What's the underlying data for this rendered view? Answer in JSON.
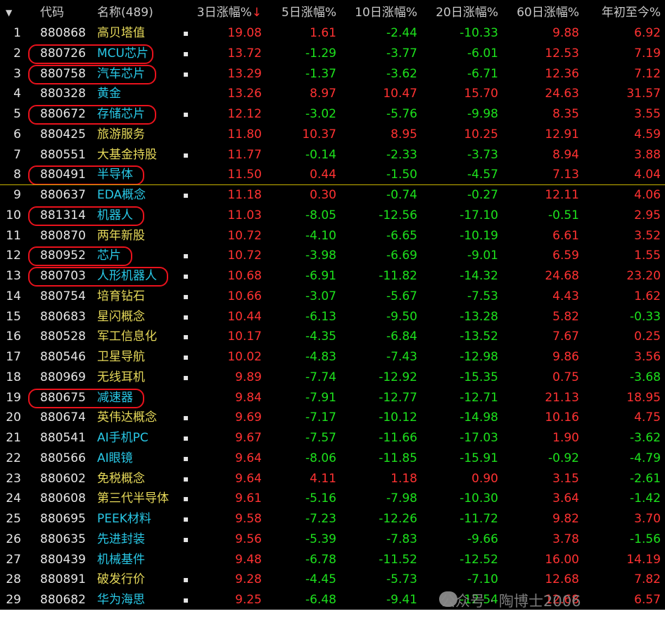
{
  "colors": {
    "up": "#ff3232",
    "down": "#1de11d",
    "name_yellow": "#e6d95a",
    "name_cyan": "#29c8e6",
    "bg": "#000000"
  },
  "header": {
    "menu_icon": "triangle-down-icon",
    "index_label": "",
    "code_label": "代码",
    "name_label": "名称(489)",
    "d3_label": "3日涨幅%",
    "d3_sort_arrow": "↓",
    "d5_label": "5日涨幅%",
    "d10_label": "10日涨幅%",
    "d20_label": "20日涨幅%",
    "d60_label": "60日涨幅%",
    "ytd_label": "年初至今%"
  },
  "rows": [
    {
      "idx": "1",
      "code": "880868",
      "name": "高贝塔值",
      "name_color": "yellow",
      "dot": "▪",
      "d3": "19.08",
      "d5": "1.61",
      "d10": "-2.44",
      "d20": "-10.33",
      "d60": "9.88",
      "ytd": "6.92",
      "circled": false
    },
    {
      "idx": "2",
      "code": "880726",
      "name": "MCU芯片",
      "name_color": "cyan",
      "dot": "▪",
      "d3": "13.72",
      "d5": "-1.29",
      "d10": "-3.77",
      "d20": "-6.01",
      "d60": "12.53",
      "ytd": "7.19",
      "circled": true
    },
    {
      "idx": "3",
      "code": "880758",
      "name": "汽车芯片",
      "name_color": "cyan",
      "dot": "▪",
      "d3": "13.29",
      "d5": "-1.37",
      "d10": "-3.62",
      "d20": "-6.71",
      "d60": "12.36",
      "ytd": "7.12",
      "circled": true
    },
    {
      "idx": "4",
      "code": "880328",
      "name": "黄金",
      "name_color": "cyan",
      "dot": "",
      "d3": "13.26",
      "d5": "8.97",
      "d10": "10.47",
      "d20": "15.70",
      "d60": "24.63",
      "ytd": "31.57",
      "circled": false
    },
    {
      "idx": "5",
      "code": "880672",
      "name": "存储芯片",
      "name_color": "cyan",
      "dot": "▪",
      "d3": "12.12",
      "d5": "-3.02",
      "d10": "-5.76",
      "d20": "-9.98",
      "d60": "8.35",
      "ytd": "3.55",
      "circled": true
    },
    {
      "idx": "6",
      "code": "880425",
      "name": "旅游服务",
      "name_color": "yellow",
      "dot": "",
      "d3": "11.80",
      "d5": "10.37",
      "d10": "8.95",
      "d20": "10.25",
      "d60": "12.91",
      "ytd": "4.59",
      "circled": false
    },
    {
      "idx": "7",
      "code": "880551",
      "name": "大基金持股",
      "name_color": "yellow",
      "dot": "▪",
      "d3": "11.77",
      "d5": "-0.14",
      "d10": "-2.33",
      "d20": "-3.73",
      "d60": "8.94",
      "ytd": "3.88",
      "circled": false
    },
    {
      "idx": "8",
      "code": "880491",
      "name": "半导体",
      "name_color": "cyan",
      "dot": "",
      "d3": "11.50",
      "d5": "0.44",
      "d10": "-1.50",
      "d20": "-4.57",
      "d60": "7.13",
      "ytd": "4.04",
      "circled": true
    },
    {
      "idx": "9",
      "code": "880637",
      "name": "EDA概念",
      "name_color": "cyan",
      "dot": "▪",
      "d3": "11.18",
      "d5": "0.30",
      "d10": "-0.74",
      "d20": "-0.27",
      "d60": "12.11",
      "ytd": "4.06",
      "circled": false
    },
    {
      "idx": "10",
      "code": "881314",
      "name": "机器人",
      "name_color": "cyan",
      "dot": "",
      "d3": "11.03",
      "d5": "-8.05",
      "d10": "-12.56",
      "d20": "-17.10",
      "d60": "-0.51",
      "ytd": "2.95",
      "circled": true
    },
    {
      "idx": "11",
      "code": "880870",
      "name": "两年新股",
      "name_color": "yellow",
      "dot": "",
      "d3": "10.72",
      "d5": "-4.10",
      "d10": "-6.65",
      "d20": "-10.19",
      "d60": "6.61",
      "ytd": "3.52",
      "circled": false
    },
    {
      "idx": "12",
      "code": "880952",
      "name": "芯片",
      "name_color": "cyan",
      "dot": "▪",
      "d3": "10.72",
      "d5": "-3.98",
      "d10": "-6.69",
      "d20": "-9.01",
      "d60": "6.59",
      "ytd": "1.55",
      "circled": true
    },
    {
      "idx": "13",
      "code": "880703",
      "name": "人形机器人",
      "name_color": "cyan",
      "dot": "▪",
      "d3": "10.68",
      "d5": "-6.91",
      "d10": "-11.82",
      "d20": "-14.32",
      "d60": "24.68",
      "ytd": "23.20",
      "circled": true
    },
    {
      "idx": "14",
      "code": "880754",
      "name": "培育钻石",
      "name_color": "yellow",
      "dot": "▪",
      "d3": "10.66",
      "d5": "-3.07",
      "d10": "-5.67",
      "d20": "-7.53",
      "d60": "4.43",
      "ytd": "1.62",
      "circled": false
    },
    {
      "idx": "15",
      "code": "880683",
      "name": "星闪概念",
      "name_color": "yellow",
      "dot": "▪",
      "d3": "10.44",
      "d5": "-6.13",
      "d10": "-9.50",
      "d20": "-13.28",
      "d60": "5.82",
      "ytd": "-0.33",
      "circled": false
    },
    {
      "idx": "16",
      "code": "880528",
      "name": "军工信息化",
      "name_color": "yellow",
      "dot": "▪",
      "d3": "10.17",
      "d5": "-4.35",
      "d10": "-6.84",
      "d20": "-13.52",
      "d60": "7.67",
      "ytd": "0.25",
      "circled": false
    },
    {
      "idx": "17",
      "code": "880546",
      "name": "卫星导航",
      "name_color": "yellow",
      "dot": "▪",
      "d3": "10.02",
      "d5": "-4.83",
      "d10": "-7.43",
      "d20": "-12.98",
      "d60": "9.86",
      "ytd": "3.56",
      "circled": false
    },
    {
      "idx": "18",
      "code": "880969",
      "name": "无线耳机",
      "name_color": "yellow",
      "dot": "▪",
      "d3": "9.89",
      "d5": "-7.74",
      "d10": "-12.92",
      "d20": "-15.35",
      "d60": "0.75",
      "ytd": "-3.68",
      "circled": false
    },
    {
      "idx": "19",
      "code": "880675",
      "name": "减速器",
      "name_color": "cyan",
      "dot": "",
      "d3": "9.84",
      "d5": "-7.91",
      "d10": "-12.77",
      "d20": "-12.71",
      "d60": "21.13",
      "ytd": "18.95",
      "circled": true
    },
    {
      "idx": "20",
      "code": "880674",
      "name": "英伟达概念",
      "name_color": "yellow",
      "dot": "▪",
      "d3": "9.69",
      "d5": "-7.17",
      "d10": "-10.12",
      "d20": "-14.98",
      "d60": "10.16",
      "ytd": "4.75",
      "circled": false
    },
    {
      "idx": "21",
      "code": "880541",
      "name": "AI手机PC",
      "name_color": "cyan",
      "dot": "▪",
      "d3": "9.67",
      "d5": "-7.57",
      "d10": "-11.66",
      "d20": "-17.03",
      "d60": "1.90",
      "ytd": "-3.62",
      "circled": false
    },
    {
      "idx": "22",
      "code": "880566",
      "name": "AI眼镜",
      "name_color": "cyan",
      "dot": "▪",
      "d3": "9.64",
      "d5": "-8.06",
      "d10": "-11.85",
      "d20": "-15.91",
      "d60": "-0.92",
      "ytd": "-4.79",
      "circled": false
    },
    {
      "idx": "23",
      "code": "880602",
      "name": "免税概念",
      "name_color": "yellow",
      "dot": "▪",
      "d3": "9.64",
      "d5": "4.11",
      "d10": "1.18",
      "d20": "0.90",
      "d60": "3.15",
      "ytd": "-2.61",
      "circled": false
    },
    {
      "idx": "24",
      "code": "880608",
      "name": "第三代半导体",
      "name_color": "yellow",
      "dot": "▪",
      "d3": "9.61",
      "d5": "-5.16",
      "d10": "-7.98",
      "d20": "-10.30",
      "d60": "3.64",
      "ytd": "-1.42",
      "circled": false
    },
    {
      "idx": "25",
      "code": "880695",
      "name": "PEEK材料",
      "name_color": "cyan",
      "dot": "▪",
      "d3": "9.58",
      "d5": "-7.23",
      "d10": "-12.26",
      "d20": "-11.72",
      "d60": "9.82",
      "ytd": "3.70",
      "circled": false
    },
    {
      "idx": "26",
      "code": "880635",
      "name": "先进封装",
      "name_color": "cyan",
      "dot": "▪",
      "d3": "9.56",
      "d5": "-5.39",
      "d10": "-7.83",
      "d20": "-9.66",
      "d60": "3.78",
      "ytd": "-1.56",
      "circled": false
    },
    {
      "idx": "27",
      "code": "880439",
      "name": "机械基件",
      "name_color": "cyan",
      "dot": "",
      "d3": "9.48",
      "d5": "-6.78",
      "d10": "-11.52",
      "d20": "-12.52",
      "d60": "16.00",
      "ytd": "14.19",
      "circled": false
    },
    {
      "idx": "28",
      "code": "880891",
      "name": "破发行价",
      "name_color": "yellow",
      "dot": "▪",
      "d3": "9.28",
      "d5": "-4.45",
      "d10": "-5.73",
      "d20": "-7.10",
      "d60": "12.68",
      "ytd": "7.82",
      "circled": false
    },
    {
      "idx": "29",
      "code": "880682",
      "name": "华为海思",
      "name_color": "cyan",
      "dot": "▪",
      "d3": "9.25",
      "d5": "-6.48",
      "d10": "-9.41",
      "d20": "-12.54",
      "d60": "12.68",
      "ytd": "6.57",
      "circled": false
    }
  ],
  "watermark": {
    "text": "公众号 · 陶博士2006",
    "icon": "wechat-icon"
  }
}
